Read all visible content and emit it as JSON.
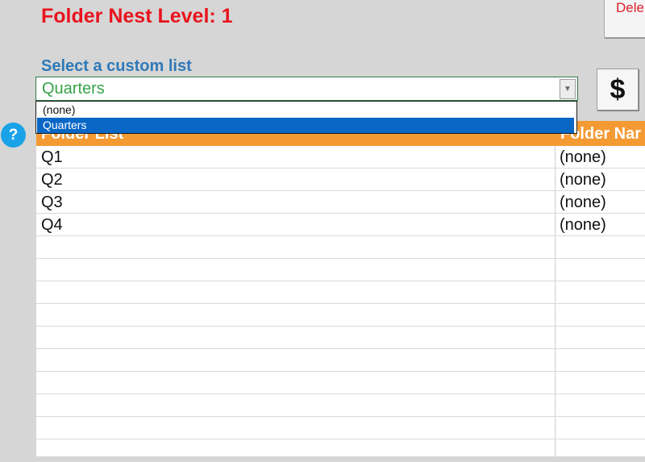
{
  "header": {
    "title": "Folder Nest Level: 1",
    "delete_label": "Dele"
  },
  "custom_list": {
    "label": "Select a custom list",
    "selected_value": "Quarters",
    "options": [
      "(none)",
      "Quarters"
    ],
    "highlighted_option": "Quarters"
  },
  "buttons": {
    "dollar_label": "$"
  },
  "help": {
    "icon_glyph": "?"
  },
  "table": {
    "columns": [
      "Folder List",
      "Folder Nar"
    ],
    "rows": [
      [
        "Q1",
        "(none)"
      ],
      [
        "Q2",
        "(none)"
      ],
      [
        "Q3",
        "(none)"
      ],
      [
        "Q4",
        "(none)"
      ]
    ]
  },
  "colors": {
    "title": "#e8141e",
    "label": "#2f79b8",
    "combo_text": "#36a34a",
    "header_fill": "#f49a33",
    "highlight": "#0a67c6",
    "help_icon": "#1aa3e8"
  }
}
